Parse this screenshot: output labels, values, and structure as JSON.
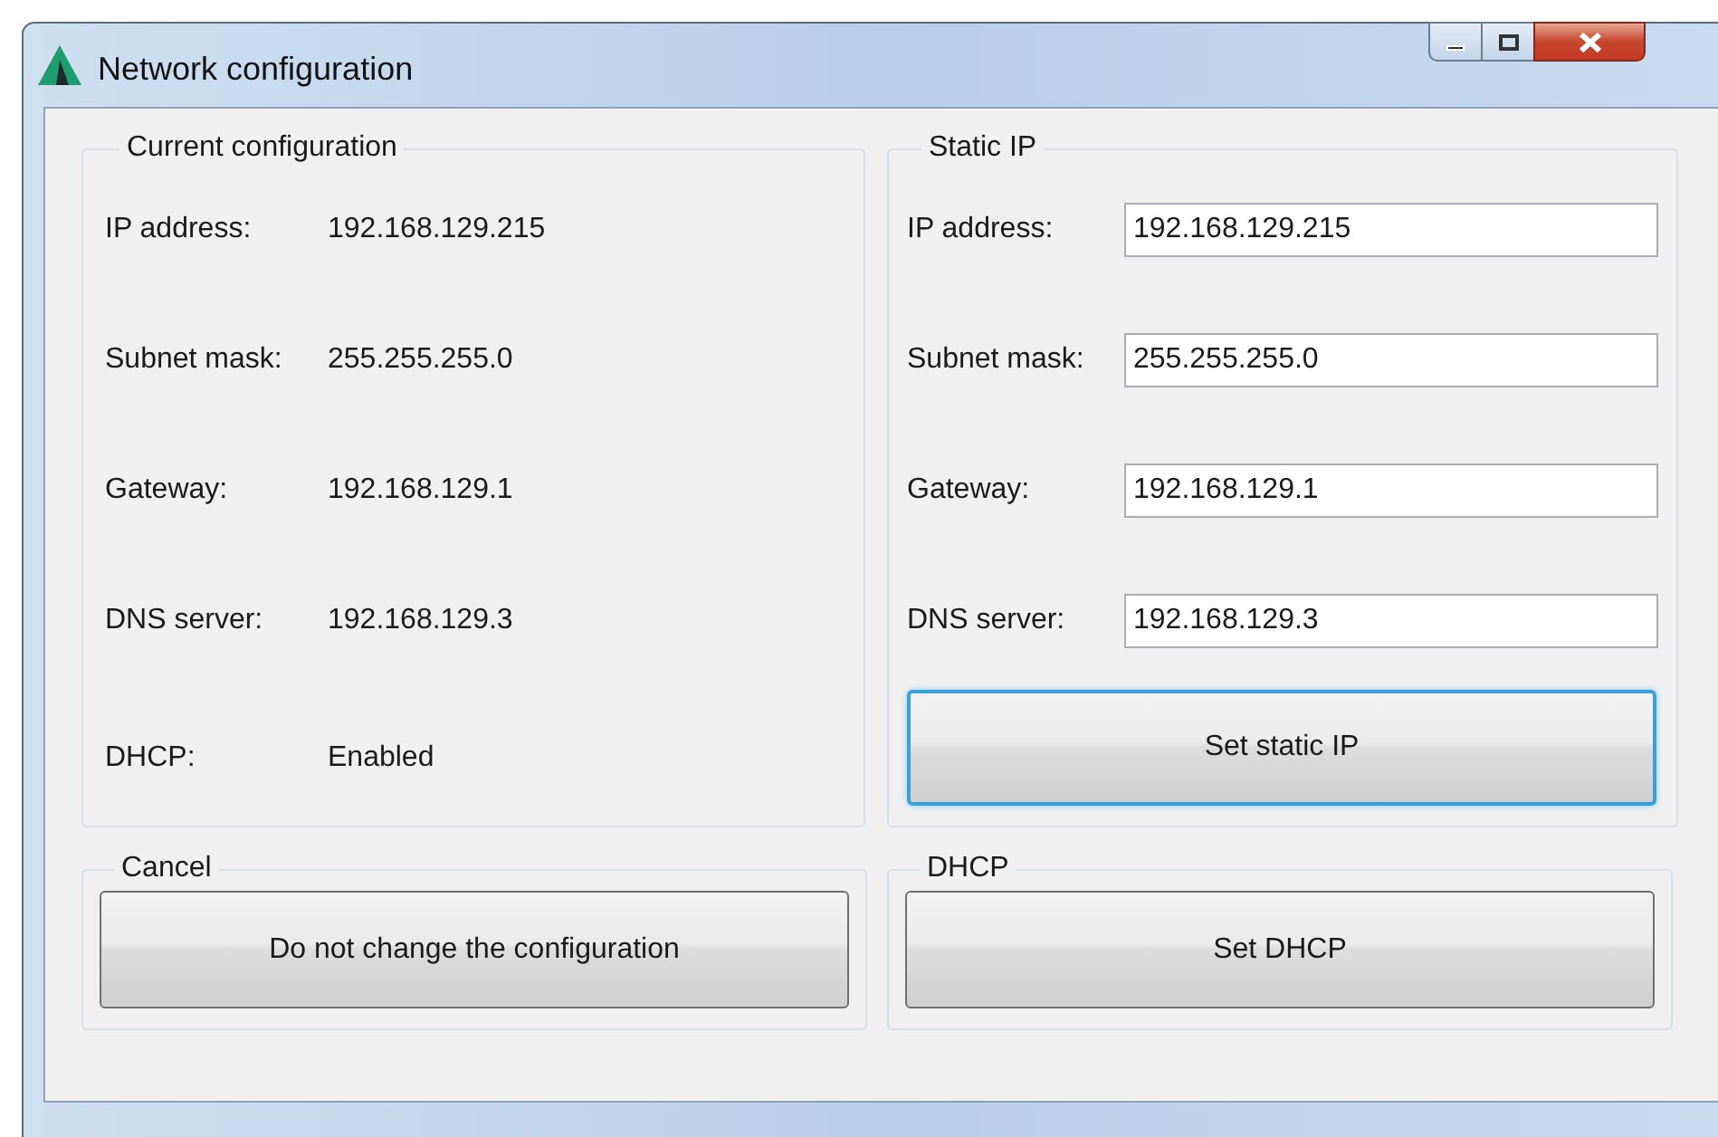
{
  "window": {
    "title": "Network configuration"
  },
  "current": {
    "title": "Current configuration",
    "rows": [
      {
        "label": "IP address:",
        "value": "192.168.129.215"
      },
      {
        "label": "Subnet mask:",
        "value": "255.255.255.0"
      },
      {
        "label": "Gateway:",
        "value": "192.168.129.1"
      },
      {
        "label": "DNS server:",
        "value": "192.168.129.3"
      },
      {
        "label": "DHCP:",
        "value": "Enabled"
      }
    ]
  },
  "static_ip": {
    "title": "Static IP",
    "fields": [
      {
        "label": "IP address:",
        "value": "192.168.129.215"
      },
      {
        "label": "Subnet mask:",
        "value": "255.255.255.0"
      },
      {
        "label": "Gateway:",
        "value": "192.168.129.1"
      },
      {
        "label": "DNS server:",
        "value": "192.168.129.3"
      }
    ],
    "button": {
      "label": "Set static IP",
      "focused": true
    }
  },
  "cancel": {
    "title": "Cancel",
    "button": {
      "label": "Do not change the configuration",
      "focused": false
    }
  },
  "dhcp": {
    "title": "DHCP",
    "button": {
      "label": "Set DHCP",
      "focused": false
    }
  }
}
